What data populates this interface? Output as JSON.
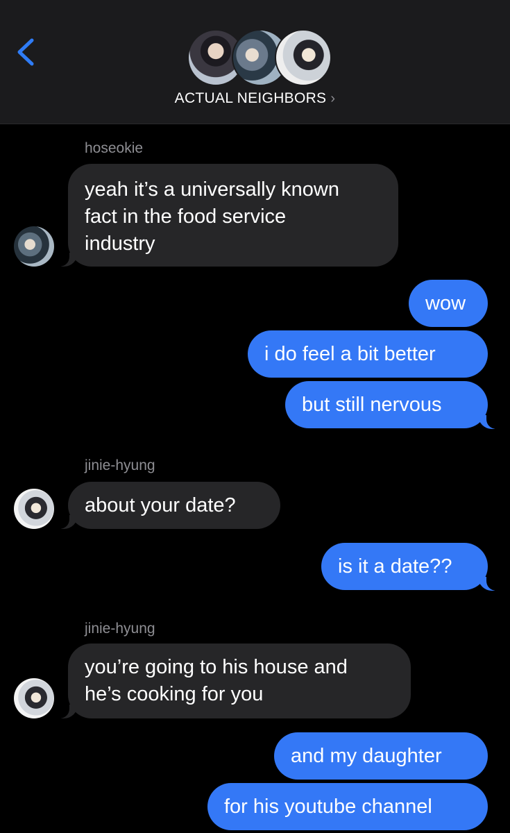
{
  "header": {
    "title": "ACTUAL NEIGHBORS",
    "title_chevron": "›",
    "back_icon": "chevron-left-icon",
    "accent": "#2f7cf6"
  },
  "colors": {
    "incoming_bubble": "#262628",
    "outgoing_bubble": "#3478f6",
    "sender_name": "#8e8e93",
    "background": "#000000"
  },
  "messages": {
    "m1": {
      "sender": "hoseokie",
      "text_lines": [
        "yeah it’s a universally known",
        "fact in the food service",
        "industry"
      ]
    },
    "m2": {
      "text": "wow"
    },
    "m3": {
      "text": "i do feel a bit better"
    },
    "m4": {
      "text": "but still nervous"
    },
    "m5": {
      "sender": "jinie-hyung",
      "text": "about your date?"
    },
    "m6": {
      "text": "is it a date??"
    },
    "m7": {
      "sender": "jinie-hyung",
      "text_lines": [
        "you’re going to his house and",
        "he’s cooking for you"
      ]
    },
    "m8": {
      "text": "and my daughter"
    },
    "m9": {
      "text": "for his youtube channel"
    }
  }
}
